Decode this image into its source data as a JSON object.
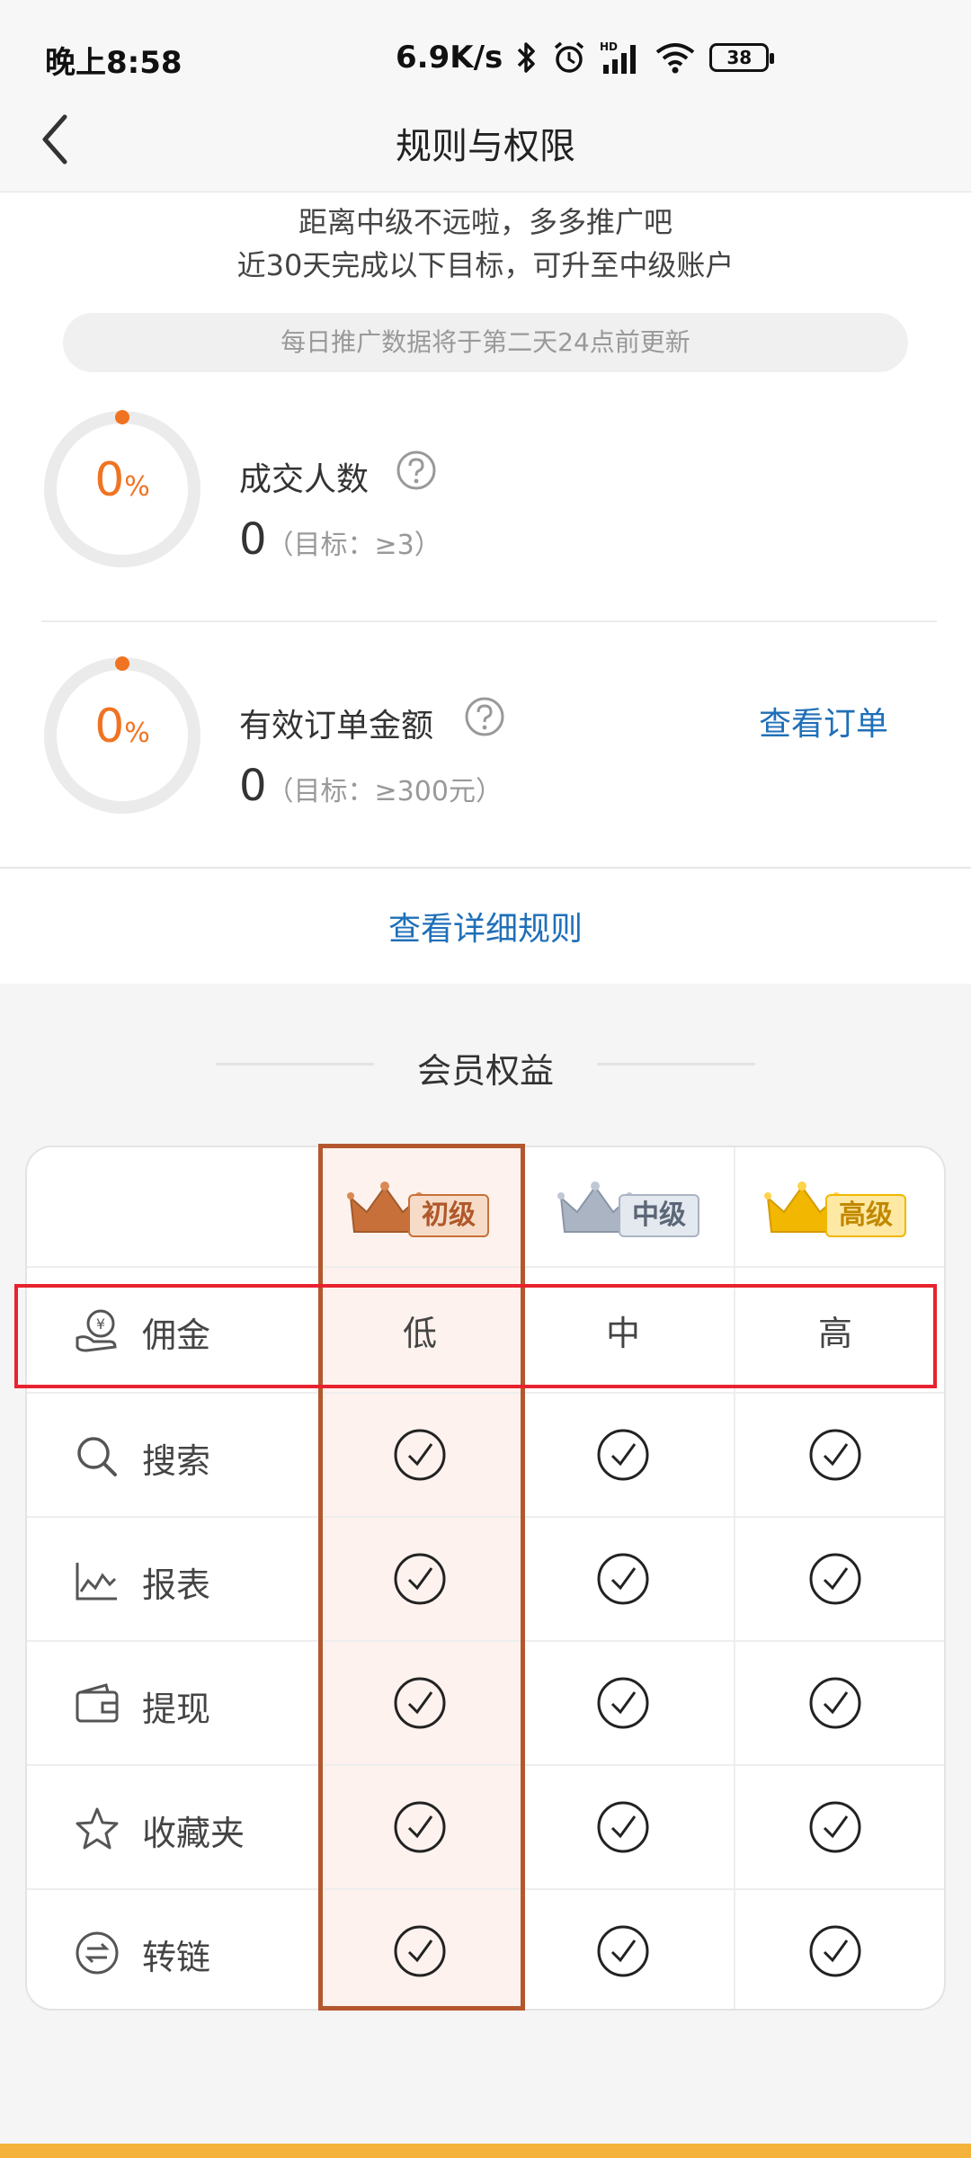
{
  "status_bar": {
    "time": "晚上8:58",
    "net_speed": "6.9K/s",
    "battery": "38",
    "icons": [
      "bluetooth-icon",
      "alarm-icon",
      "hd-signal-icon",
      "wifi-icon",
      "battery-icon"
    ]
  },
  "nav": {
    "title": "规则与权限",
    "back_icon": "chevron-left-icon"
  },
  "intro": {
    "line1": "距离中级不远啦，多多推广吧",
    "line2": "近30天完成以下目标，可升至中级账户",
    "notice": "每日推广数据将于第二天24点前更新"
  },
  "goals": [
    {
      "percent_num": "0",
      "percent_unit": "%",
      "progress": 0.0,
      "label": "成交人数",
      "value": "0",
      "target": "（目标：≥3）"
    },
    {
      "percent_num": "0",
      "percent_unit": "%",
      "progress": 0.0,
      "label": "有效订单金额",
      "value": "0",
      "target": "（目标：≥300元）",
      "link": "查看订单"
    }
  ],
  "rules_link": "查看详细规则",
  "benefits": {
    "title": "会员权益",
    "tiers": [
      {
        "label": "初级",
        "color": "#c8703a"
      },
      {
        "label": "中级",
        "color": "#8a96a8"
      },
      {
        "label": "高级",
        "color": "#e7a400"
      }
    ],
    "rows": [
      {
        "label": "佣金",
        "icon": "commission-hand-icon",
        "values": [
          "低",
          "中",
          "高"
        ]
      },
      {
        "label": "搜索",
        "icon": "search-icon",
        "values": [
          "check",
          "check",
          "check"
        ]
      },
      {
        "label": "报表",
        "icon": "chart-icon",
        "values": [
          "check",
          "check",
          "check"
        ]
      },
      {
        "label": "提现",
        "icon": "wallet-icon",
        "values": [
          "check",
          "check",
          "check"
        ]
      },
      {
        "label": "收藏夹",
        "icon": "star-icon",
        "values": [
          "check",
          "check",
          "check"
        ]
      },
      {
        "label": "转链",
        "icon": "convert-link-icon",
        "values": [
          "check",
          "check",
          "check"
        ]
      }
    ]
  },
  "colors": {
    "accent_orange": "#f07322",
    "link_blue": "#1f6fb8",
    "highlight_column": "#b3582e",
    "highlight_row": "#e8222e"
  }
}
